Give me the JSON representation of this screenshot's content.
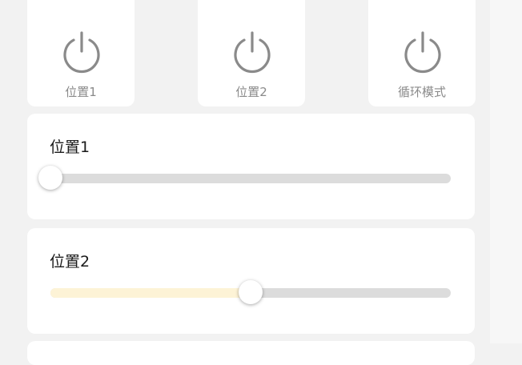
{
  "tiles": [
    {
      "label": "位置1",
      "icon": "power-icon"
    },
    {
      "label": "位置2",
      "icon": "power-icon"
    },
    {
      "label": "循环模式",
      "icon": "power-icon"
    }
  ],
  "cards": [
    {
      "title": "位置1",
      "slider_value_pct": 0
    },
    {
      "title": "位置2",
      "slider_value_pct": 50
    }
  ],
  "colors": {
    "background": "#f2f2f2",
    "card": "#ffffff",
    "icon": "#8a8a8a",
    "track": "#dcdcdc",
    "fill": "#fdf3d6"
  }
}
